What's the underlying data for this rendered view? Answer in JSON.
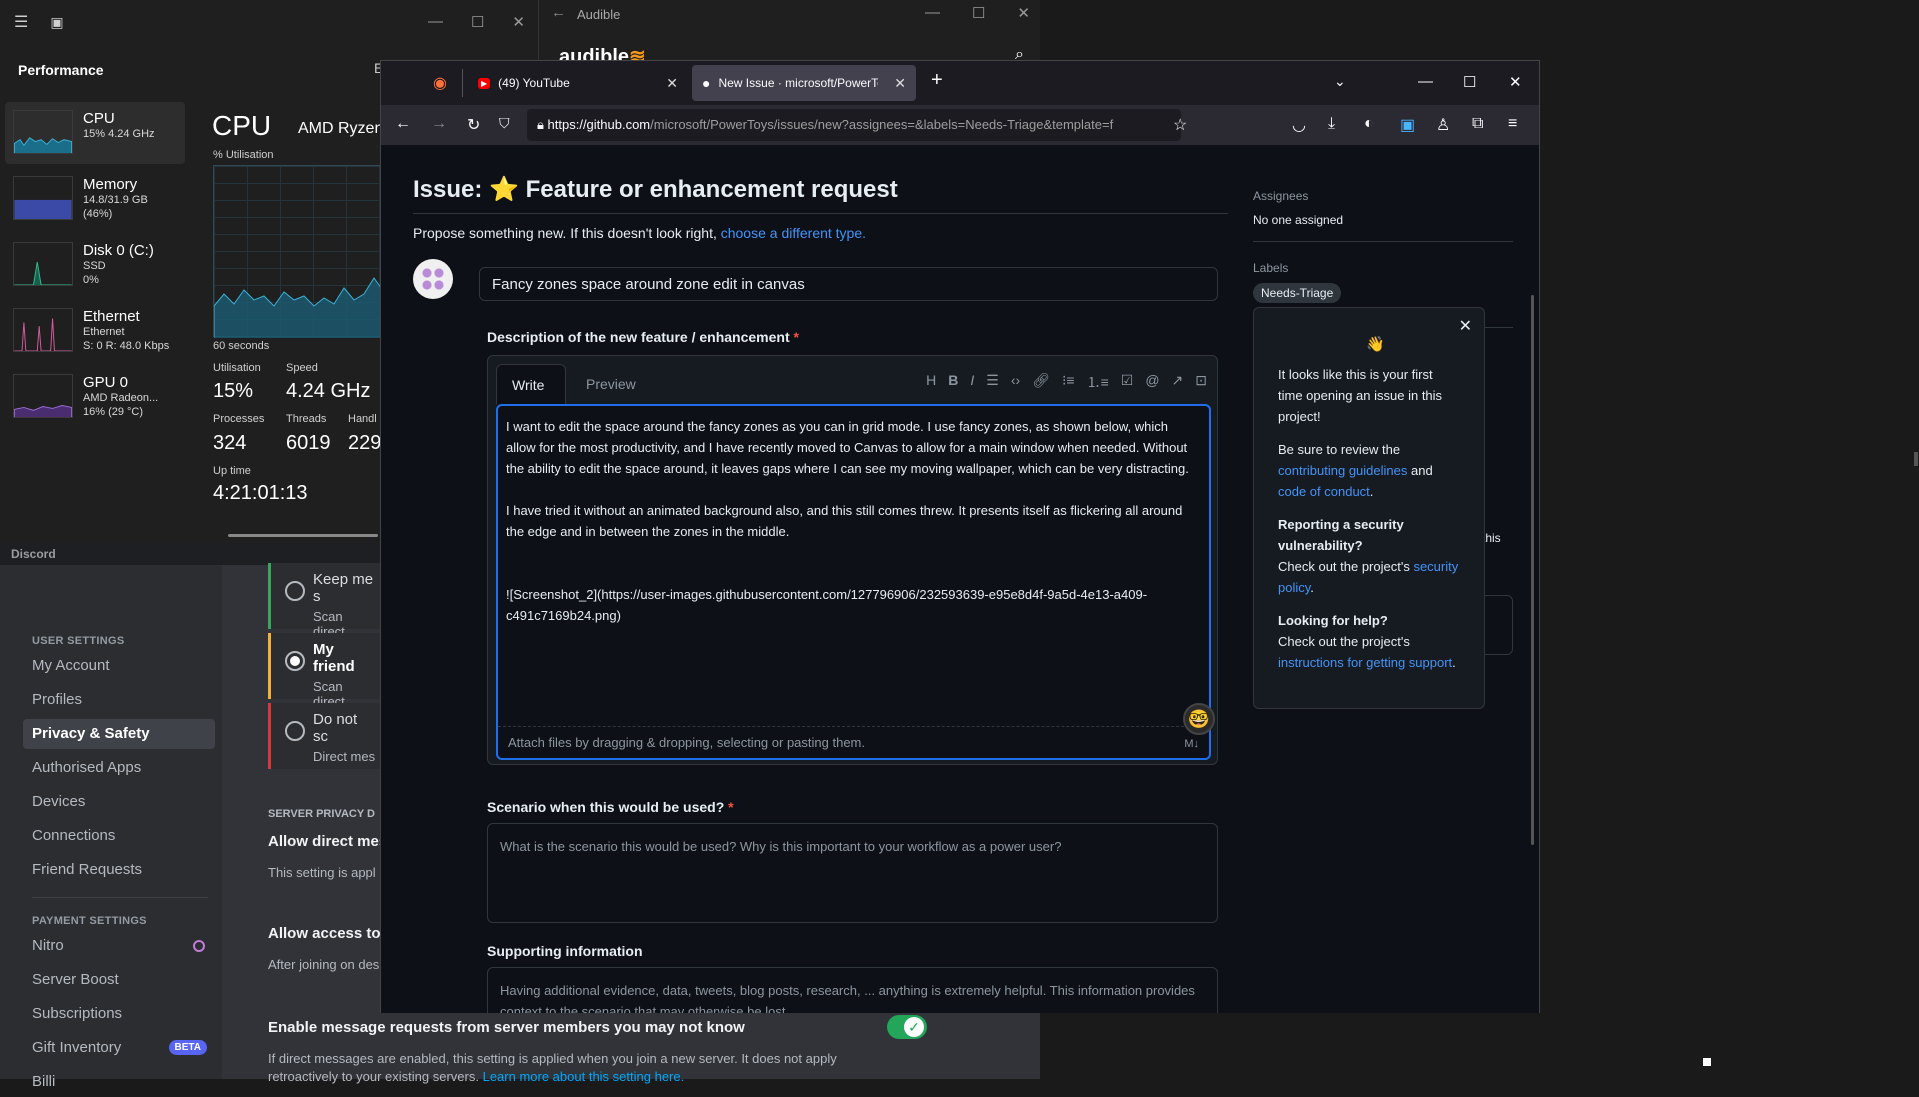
{
  "taskmanager": {
    "section": "Performance",
    "cut_label": "E",
    "items": [
      {
        "title": "CPU",
        "sub1": "15% 4.24 GHz",
        "sub2": "",
        "sub3": ""
      },
      {
        "title": "Memory",
        "sub1": "14.8/31.9 GB (46%)",
        "sub2": "",
        "sub3": ""
      },
      {
        "title": "Disk 0 (C:)",
        "sub1": "SSD",
        "sub2": "0%",
        "sub3": ""
      },
      {
        "title": "Ethernet",
        "sub1": "Ethernet",
        "sub2": "S: 0 R: 48.0 Kbps",
        "sub3": ""
      },
      {
        "title": "GPU 0",
        "sub1": "AMD Radeon...",
        "sub2": "16% (29 °C)",
        "sub3": ""
      }
    ],
    "heading": "CPU",
    "cpu_name": "AMD Ryzen",
    "util_label": "% Utilisation",
    "seconds_label": "60 seconds",
    "stats": {
      "utilisation_label": "Utilisation",
      "utilisation": "15%",
      "speed_label": "Speed",
      "speed": "4.24 GHz",
      "processes_label": "Processes",
      "processes": "324",
      "threads_label": "Threads",
      "threads": "6019",
      "handles_label": "Handl",
      "handles": "229",
      "uptime_label": "Up time",
      "uptime": "4:21:01:13"
    }
  },
  "audible": {
    "title": "Audible",
    "logo": "audible"
  },
  "discord": {
    "app": "Discord",
    "user_settings_header": "USER SETTINGS",
    "nav": [
      "My Account",
      "Profiles",
      "Privacy & Safety",
      "Authorised Apps",
      "Devices",
      "Connections",
      "Friend Requests"
    ],
    "payment_header": "PAYMENT SETTINGS",
    "payment_nav": [
      "Nitro",
      "Server Boost",
      "Subscriptions",
      "Gift Inventory",
      "Billi"
    ],
    "beta_badge": "BETA",
    "options": [
      {
        "title": "Keep me s",
        "desc": "Scan direct"
      },
      {
        "title": "My friend",
        "desc": "Scan direct"
      },
      {
        "title": "Do not sc",
        "desc": "Direct mes"
      }
    ],
    "server_privacy_header": "SERVER PRIVACY D",
    "allow_dm_title": "Allow direct mes",
    "allow_dm_desc": "This setting is appl",
    "allow_access_title": "Allow access to",
    "allow_access_desc": "After joining on des",
    "msg_req_title": "Enable message requests from server members you may not know",
    "msg_req_desc1": "If direct messages are enabled, this setting is applied when you join a new server. It does not apply",
    "msg_req_desc2": "retroactively to your existing servers.",
    "msg_req_link": "Learn more about this setting here.",
    "stray_text": "this"
  },
  "firefox": {
    "tabs": [
      {
        "label": "(49) YouTube"
      },
      {
        "label": "New Issue · microsoft/PowerToy"
      }
    ],
    "url_host": "https://github.com",
    "url_path": "/microsoft/PowerToys/issues/new?assignees=&labels=Needs-Triage&template=f",
    "new_tab": "+"
  },
  "github": {
    "issue_prefix": "Issue:",
    "issue_emoji": "⭐",
    "issue_type": "Feature or enhancement request",
    "propose_text": "Propose something new. If this doesn't look right,",
    "propose_link": "choose a different type.",
    "title_value": "Fancy zones space around zone edit in canvas",
    "desc_label": "Description of the new feature / enhancement",
    "required_mark": "*",
    "write_tab": "Write",
    "preview_tab": "Preview",
    "description_body": "I want to edit the space around the fancy zones as you can in grid mode. I use fancy zones, as shown below, which allow for the most productivity, and I have recently moved to Canvas to allow for a main window when needed. Without the ability to edit the space around, it leaves gaps where I can see my moving wallpaper, which can be very distracting.\n\nI have tried it without an animated background also, and this still comes threw. It presents itself as flickering all around the edge and in between the zones in the middle.\n\n\n![Screenshot_2](https://user-images.githubusercontent.com/127796906/232593639-e95e8d4f-9a5d-4e13-a409-c491c7169b24.png)",
    "attach_text": "Attach files by dragging & dropping, selecting or pasting them.",
    "scenario_label": "Scenario when this would be used?",
    "scenario_placeholder": "What is the scenario this would be used? Why is this important to your workflow as a power user?",
    "supporting_label": "Supporting information",
    "supporting_placeholder": "Having additional evidence, data, tweets, blog posts, research, ... anything is extremely helpful. This information provides context to the scenario that may otherwise be lost.",
    "assignees_label": "Assignees",
    "assignees_value": "No one assigned",
    "labels_label": "Labels",
    "label_badge": "Needs-Triage",
    "popover": {
      "wave": "👋",
      "p1": "It looks like this is your first time opening an issue in this project!",
      "p2_pre": "Be sure to review the",
      "p2_link1": "contributing guidelines",
      "p2_mid": "and",
      "p2_link2": "code of conduct",
      "p3_title": "Reporting a security vulnerability?",
      "p3_pre": "Check out the project's",
      "p3_link": "security policy",
      "p4_title": "Looking for help?",
      "p4_pre": "Check out the project's",
      "p4_link": "instructions for getting support"
    }
  }
}
